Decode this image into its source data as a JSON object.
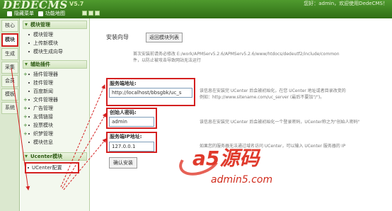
{
  "header": {
    "logo": "DEDECMS",
    "version": "V5.7",
    "user_info": "您好：admin，欢迎使用DedeCMS！",
    "nav": [
      {
        "label": "隐藏菜单",
        "icon": "hide-menu-icon"
      },
      {
        "label": "功能地图",
        "icon": "map-icon"
      }
    ]
  },
  "vtabs": [
    {
      "label": "核心"
    },
    {
      "label": "模块"
    },
    {
      "label": "生成"
    },
    {
      "label": "采集"
    },
    {
      "label": "会员"
    },
    {
      "label": "模板"
    },
    {
      "label": "系统"
    }
  ],
  "menu": {
    "group1": {
      "title": "模块管理",
      "items": [
        "模块管理",
        "上传新模块",
        "模块生成向导"
      ]
    },
    "group2": {
      "title": "辅助插件",
      "items": [
        "插件管理器",
        "挂件管理",
        "百度新闻",
        "文件管理器",
        "广告管理",
        "友情链接",
        "投票模块",
        "织梦管理",
        "模块信息"
      ]
    },
    "group3": {
      "title": "Ucenter模块",
      "item": "UCenter配置"
    }
  },
  "main": {
    "title": "安装向导",
    "back_button": "返回模块列表",
    "notice_lines": [
      "首次安装前请务必修改 E:/work/APMServ5.2.6/APMServ5.2.6/www/htdocs/dedeutf2/include/common",
      "件，以防止被攻击导致网站无法运行"
    ],
    "fields": [
      {
        "label": "服务端地址:",
        "value": "http://localhost/bbsgbk/uc_s",
        "hint1": "该信息在安装完 UCenter 后会被初始化，在您 UCenter 地址或者目录改变的",
        "hint2": "例如：http://www.sitename.com/uc_server (最后不要加\"/\")。"
      },
      {
        "label": "创始人密码:",
        "value": "admin",
        "hint1": "该信息在安装完 UCenter 后会被初始化一个登录密码，UCenter称之为\"创始人密码\""
      },
      {
        "label": "服务端IP地址:",
        "value": "127.0.0.1",
        "hint1": "如果您的服务器无法通过域名访问 UCenter，可以输入 UCenter 服务器的 IP"
      }
    ],
    "install_button": "确认安装"
  },
  "watermark": {
    "brand": "a5源码",
    "url": "admin5.com"
  }
}
